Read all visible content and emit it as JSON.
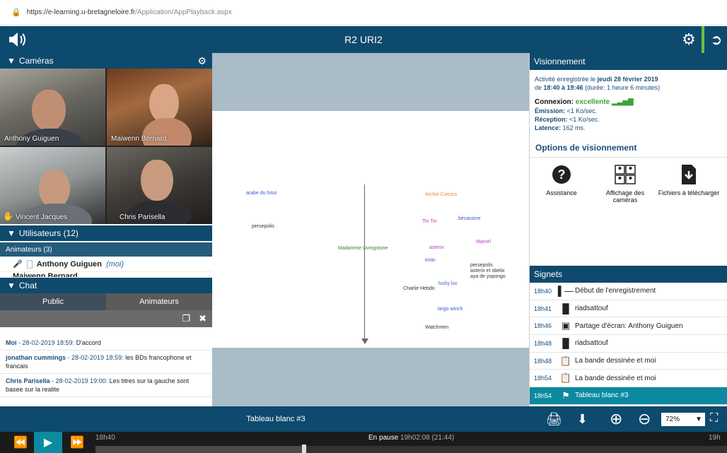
{
  "browser": {
    "url_host": "https://e-learning.u-bretagneloire.fr",
    "url_path": "/Application/AppPlayback.aspx"
  },
  "topbar": {
    "title": "R2 URI2"
  },
  "cameras": {
    "header": "Caméras",
    "feeds": [
      "Anthony Guiguen",
      "Maiwenn Bernard",
      "Vincent Jacques",
      "Chris Parisella"
    ]
  },
  "users": {
    "header": "Utilisateurs (12)",
    "group": "Animateurs (3)",
    "list": [
      {
        "name": "Anthony Guiguen",
        "suffix": "(moi)"
      },
      {
        "name": "Maiwenn Bernard",
        "suffix": ""
      }
    ]
  },
  "chat": {
    "header": "Chat",
    "tabs": [
      "Public",
      "Animateurs"
    ],
    "messages": [
      {
        "author": "Moi",
        "time": " - 28-02-2019 18:59: ",
        "text": "D'accord"
      },
      {
        "author": "jonathan cummings",
        "time": " - 28-02-2019 18:59: ",
        "text": "les BDs francophone et francais"
      },
      {
        "author": "Chris Parisella",
        "time": " - 28-02-2019 19:00: ",
        "text": "Les titres sur la gauche sont basee sur la realite"
      }
    ]
  },
  "whiteboard": {
    "words": [
      "arabe du futur",
      "persepolis",
      "Madamme Livingstone",
      "Archie Comics",
      "Tin Tin",
      "bécassine",
      "Marvel",
      "asterix",
      "tintin",
      "persepolis",
      "asterix et obelix",
      "aya de yopongo",
      "lucky luc",
      "Charlie Hebdo",
      "largo winch",
      "Watchmen"
    ],
    "colors": {
      "orange": "#e8873a",
      "purple": "#b43cc0",
      "blue": "#3a5ad0",
      "green": "#2a8a2a",
      "dark": "#333333"
    }
  },
  "viewing": {
    "header": "Visionnement",
    "recorded_prefix": "Activité enregistrée le ",
    "recorded_date": "jeudi 28 février 2019",
    "recorded_de": "de ",
    "recorded_range": "18:40 à 19:46",
    "recorded_duration": " (durée: 1 heure 6 minutes)",
    "connexion_label": "Connexion: ",
    "connexion_value": "excellente",
    "emission_label": "Émission: ",
    "emission_value": "<1 Ko/sec.",
    "reception_label": "Réception: ",
    "reception_value": "<1 Ko/sec.",
    "latence_label": "Latence: ",
    "latence_value": "162 ms.",
    "options_title": "Options de visionnement",
    "options": [
      "Assistance",
      "Affichage des caméras",
      "Fichiers à télécharger"
    ]
  },
  "bookmarks": {
    "header": "Signets",
    "items": [
      {
        "time": "18h40",
        "icon": "record-start-icon",
        "label": "Début de l'enregistrement"
      },
      {
        "time": "18h41",
        "icon": "document-icon",
        "label": "riadsattouf"
      },
      {
        "time": "18h46",
        "icon": "screen-share-icon",
        "label": "Partage d'écran: Anthony Guiguen"
      },
      {
        "time": "18h48",
        "icon": "document-icon",
        "label": "riadsattouf"
      },
      {
        "time": "18h48",
        "icon": "clipboard-icon",
        "label": "La bande dessinée et moi"
      },
      {
        "time": "18h54",
        "icon": "clipboard-icon",
        "label": "La bande dessinée et moi"
      },
      {
        "time": "18h54",
        "icon": "tag-icon",
        "label": "Tableau blanc #3"
      }
    ]
  },
  "toolbar": {
    "doc_title": "Tableau blanc #3",
    "zoom": "72%"
  },
  "player": {
    "start": "18h40",
    "status": "En pause",
    "position": "19h02:08 (21:44)",
    "end": "19h"
  }
}
